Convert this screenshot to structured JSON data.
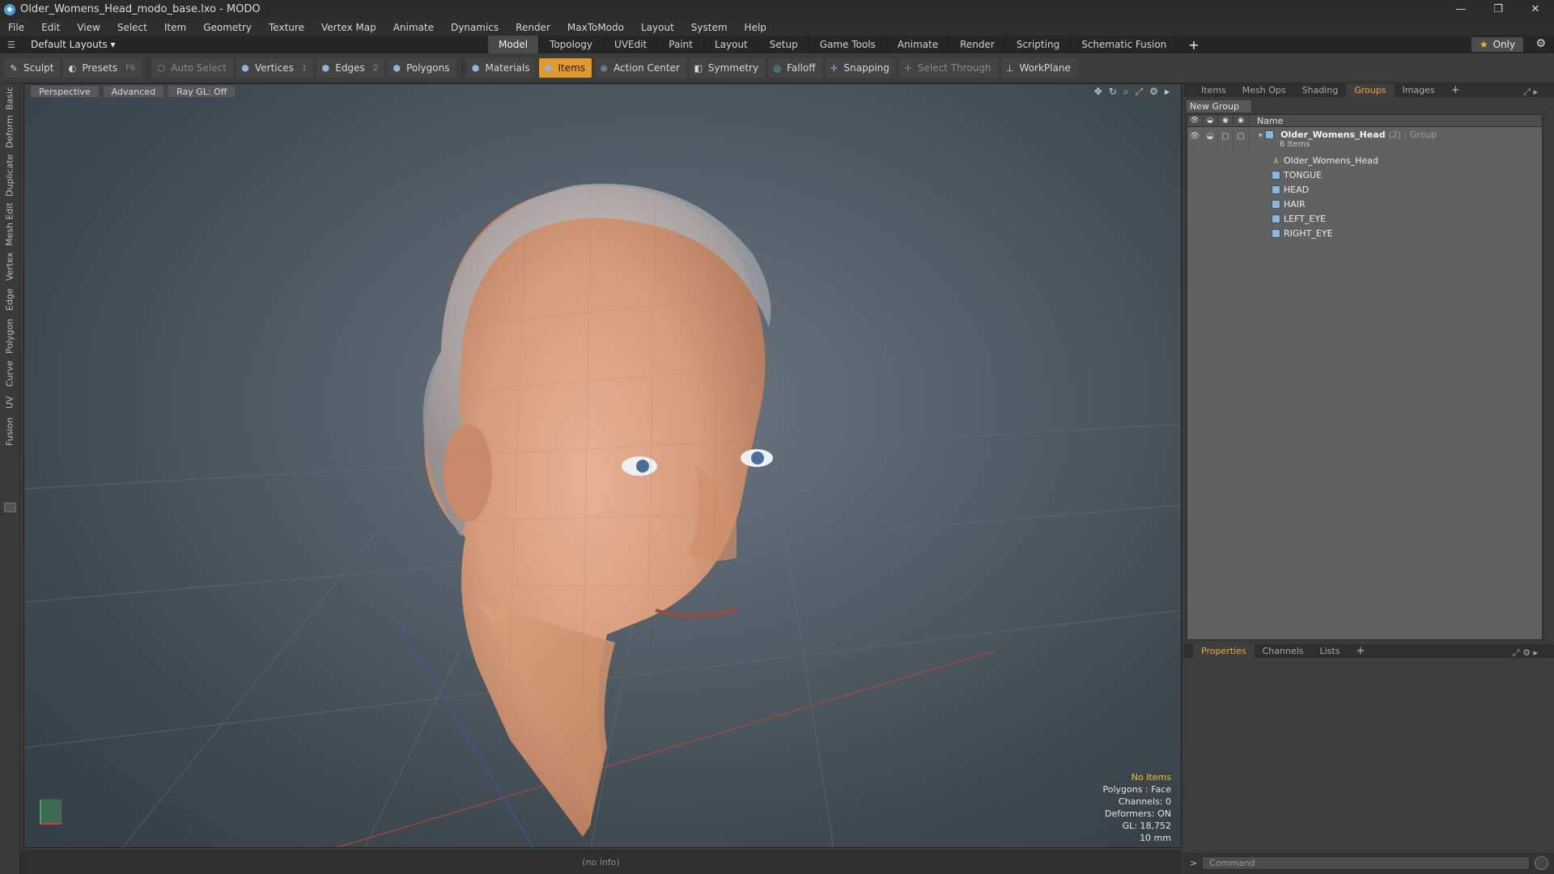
{
  "window": {
    "title": "Older_Womens_Head_modo_base.lxo - MODO",
    "controls": [
      "—",
      "❐",
      "✕"
    ]
  },
  "menu": [
    "File",
    "Edit",
    "View",
    "Select",
    "Item",
    "Geometry",
    "Texture",
    "Vertex Map",
    "Animate",
    "Dynamics",
    "Render",
    "MaxToModo",
    "Layout",
    "System",
    "Help"
  ],
  "layouts": {
    "selector": "Default Layouts ▾",
    "tabs": [
      "Model",
      "Topology",
      "UVEdit",
      "Paint",
      "Layout",
      "Setup",
      "Game Tools",
      "Animate",
      "Render",
      "Scripting",
      "Schematic Fusion"
    ],
    "active_tab": "Model",
    "add": "+",
    "only_label": "Only"
  },
  "toolbar": {
    "sculpt": "Sculpt",
    "presets": "Presets",
    "presets_key": "F6",
    "auto_select": "Auto Select",
    "vertices": "Vertices",
    "vertices_count": "1",
    "edges": "Edges",
    "edges_count": "2",
    "polygons": "Polygons",
    "materials": "Materials",
    "items": "Items",
    "action_center": "Action Center",
    "symmetry": "Symmetry",
    "falloff": "Falloff",
    "snapping": "Snapping",
    "select_through": "Select Through",
    "workplane": "WorkPlane"
  },
  "left_tabs": [
    "Basic",
    "Deform",
    "Duplicate",
    "Mesh Edit",
    "Vertex",
    "Edge",
    "Polygon",
    "Curve",
    "UV",
    "Fusion"
  ],
  "viewport": {
    "view": "Perspective",
    "shading": "Advanced",
    "raygl": "Ray GL: Off",
    "info": {
      "no_items": "No Items",
      "polygons": "Polygons : Face",
      "channels": "Channels: 0",
      "deformers": "Deformers: ON",
      "gl": "GL: 18,752",
      "scale": "10 mm"
    }
  },
  "status": "(no info)",
  "right_panel": {
    "tabs": [
      "Items",
      "Mesh Ops",
      "Shading",
      "Groups",
      "Images"
    ],
    "active_tab": "Groups",
    "add": "+",
    "new_group": "New Group",
    "name_col": "Name",
    "group": {
      "name": "Older_Womens_Head",
      "meta": "(2) : Group",
      "sub": "6 Items"
    },
    "children": [
      "Older_Womens_Head",
      "TONGUE",
      "HEAD",
      "HAIR",
      "LEFT_EYE",
      "RIGHT_EYE"
    ],
    "props_tabs": [
      "Properties",
      "Channels",
      "Lists"
    ],
    "props_active": "Properties",
    "command_placeholder": "Command"
  },
  "colors": {
    "accent": "#e39a2d",
    "tab_active_text": "#f0a838"
  }
}
